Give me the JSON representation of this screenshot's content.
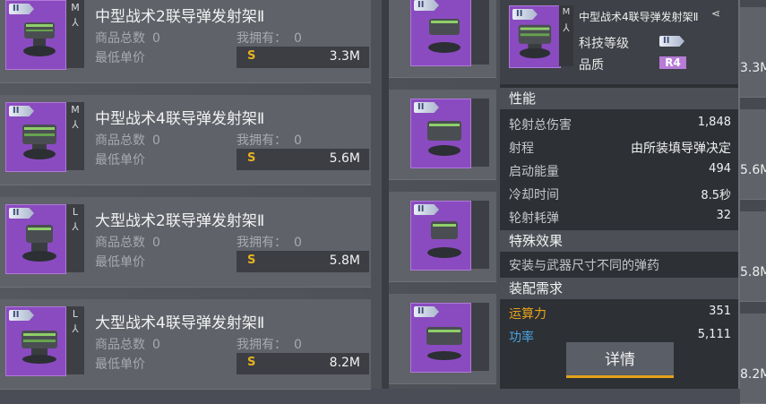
{
  "labels": {
    "total": "商品总数",
    "own": "我拥有：",
    "min_price": "最低单价",
    "coin": "S"
  },
  "listings": [
    {
      "tier": "II",
      "size": "M",
      "name": "中型战术2联导弹发射架Ⅱ",
      "total": "0",
      "own": "0",
      "price": "3.3M"
    },
    {
      "tier": "II",
      "size": "M",
      "name": "中型战术4联导弹发射架Ⅱ",
      "total": "0",
      "own": "0",
      "price": "5.6M"
    },
    {
      "tier": "II",
      "size": "L",
      "name": "大型战术2联导弹发射架Ⅱ",
      "total": "0",
      "own": "0",
      "price": "5.8M"
    },
    {
      "tier": "II",
      "size": "L",
      "name": "大型战术4联导弹发射架Ⅱ",
      "total": "0",
      "own": "0",
      "price": "8.2M"
    }
  ],
  "right_prices": [
    "3.3M",
    "5.6M",
    "5.8M",
    "8.2M"
  ],
  "tooltip": {
    "name": "中型战术4联导弹发射架Ⅱ",
    "share_icon": "share-icon",
    "tech_label": "科技等级",
    "tech_tier": "II",
    "quality_label": "品质",
    "quality": "R4",
    "size": "M",
    "sections": {
      "performance": "性能",
      "special": "特殊效果",
      "requirements": "装配需求"
    },
    "stats": [
      {
        "label": "轮射总伤害",
        "value": "1,848"
      },
      {
        "label": "射程",
        "value": "由所装填导弹决定"
      },
      {
        "label": "启动能量",
        "value": "494"
      },
      {
        "label": "冷却时间",
        "value": "8.5秒"
      },
      {
        "label": "轮射耗弹",
        "value": "32"
      }
    ],
    "special_text": "安装与武器尺寸不同的弹药",
    "requirements": [
      {
        "label": "运算力",
        "value": "351",
        "color": "#e8a21a"
      },
      {
        "label": "功率",
        "value": "5,111",
        "color": "#4aa3e0"
      }
    ],
    "details_button": "详情"
  },
  "colors": {
    "quality": "#b77bd8",
    "coin": "#e6b31e",
    "accent": "#e2a21a"
  }
}
